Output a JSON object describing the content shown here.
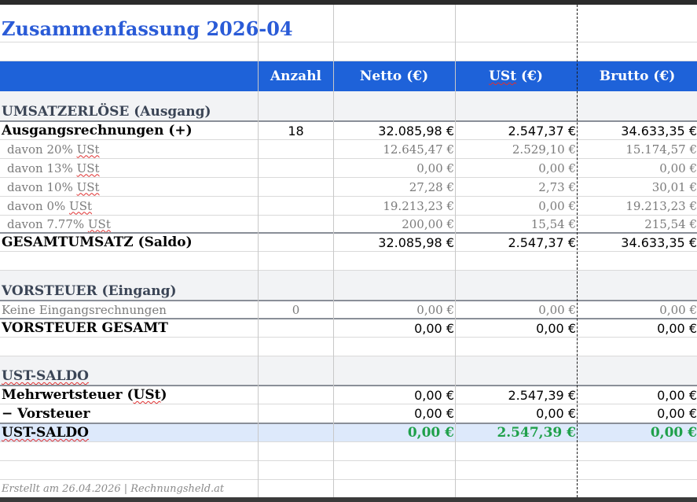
{
  "title": "Zusammenfassung 2026-04",
  "header": {
    "col0": "",
    "col1": "Anzahl",
    "col2": "Netto (€)",
    "col3": "USt (€)",
    "col4": "Brutto (€)"
  },
  "umsatz": {
    "section": "UMSATZERLÖSE (Ausgang)",
    "main": {
      "label": "Ausgangsrechnungen (+)",
      "anzahl": "18",
      "netto": "32.085,98 €",
      "ust": "2.547,37 €",
      "brutto": "34.633,35 €"
    },
    "rows": [
      {
        "label": "davon 20% USt",
        "netto": "12.645,47 €",
        "ust": "2.529,10 €",
        "brutto": "15.174,57 €"
      },
      {
        "label": "davon 13% USt",
        "netto": "0,00 €",
        "ust": "0,00 €",
        "brutto": "0,00 €"
      },
      {
        "label": "davon 10% USt",
        "netto": "27,28 €",
        "ust": "2,73 €",
        "brutto": "30,01 €"
      },
      {
        "label": "davon 0% USt",
        "netto": "19.213,23 €",
        "ust": "0,00 €",
        "brutto": "19.213,23 €"
      },
      {
        "label": "davon 7.77% USt",
        "netto": "200,00 €",
        "ust": "15,54 €",
        "brutto": "215,54 €"
      }
    ],
    "total": {
      "label": "GESAMTUMSATZ (Saldo)",
      "netto": "32.085,98 €",
      "ust": "2.547,37 €",
      "brutto": "34.633,35 €"
    }
  },
  "vorsteuer": {
    "section": "VORSTEUER (Eingang)",
    "row": {
      "label": "Keine Eingangsrechnungen",
      "anzahl": "0",
      "netto": "0,00 €",
      "ust": "0,00 €",
      "brutto": "0,00 €"
    },
    "total": {
      "label": "VORSTEUER GESAMT",
      "netto": "0,00 €",
      "ust": "0,00 €",
      "brutto": "0,00 €"
    }
  },
  "ustsaldo": {
    "section": "UST-SALDO",
    "mwst": {
      "label": "Mehrwertsteuer (USt)",
      "netto": "0,00 €",
      "ust": "2.547,39 €",
      "brutto": "0,00 €"
    },
    "vorst": {
      "label": "− Vorsteuer",
      "netto": "0,00 €",
      "ust": "0,00 €",
      "brutto": "0,00 €"
    },
    "saldo": {
      "label": "UST-SALDO",
      "netto": "0,00 €",
      "ust": "2.547,39 €",
      "brutto": "0,00 €"
    }
  },
  "footer": "Erstellt am 26.04.2026 | Rechnungsheld.at",
  "colors": {
    "accent": "#1e62d9",
    "title": "#2a5bd7",
    "positive": "#1fa04a",
    "saldo_bg": "#dde9fb"
  }
}
